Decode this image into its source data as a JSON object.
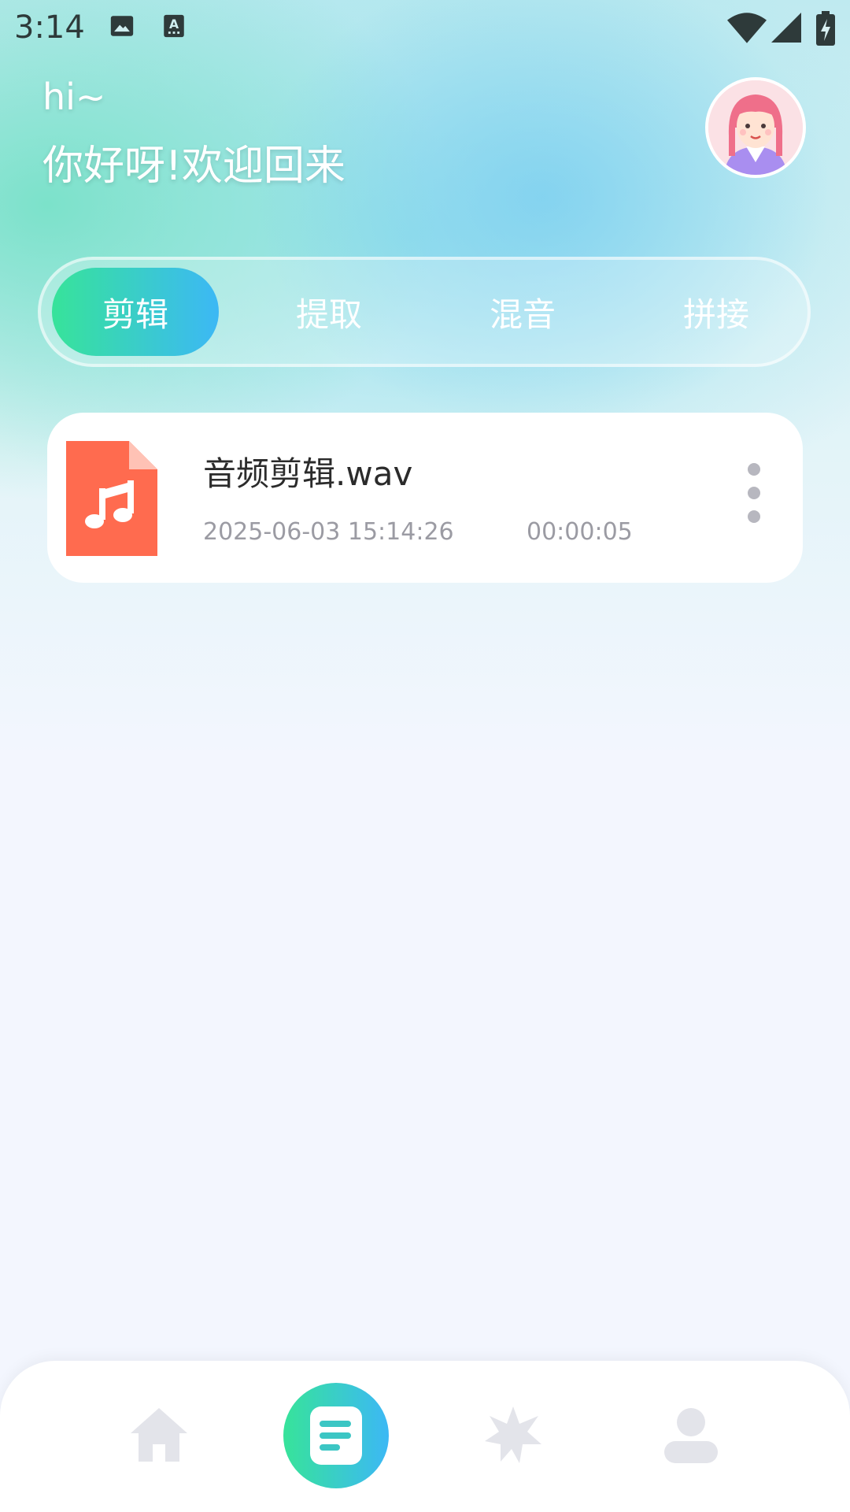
{
  "status_bar": {
    "time": "3:14",
    "left_icons": [
      "image-icon",
      "a-keyboard-icon"
    ],
    "right_icons": [
      "wifi-icon",
      "signal-icon",
      "battery-charging-icon"
    ]
  },
  "greeting": {
    "line1": "hi~",
    "line2": "你好呀!欢迎回来"
  },
  "avatar": {
    "icon": "user-avatar"
  },
  "tabs": [
    {
      "label": "剪辑",
      "active": true
    },
    {
      "label": "提取",
      "active": false
    },
    {
      "label": "混音",
      "active": false
    },
    {
      "label": "拼接",
      "active": false
    }
  ],
  "files": [
    {
      "name": "音频剪辑.wav",
      "date": "2025-06-03 15:14:26",
      "duration": "00:00:05",
      "icon": "audio-file-icon"
    }
  ],
  "bottom_nav": [
    {
      "icon": "home-icon",
      "active": false
    },
    {
      "icon": "list-icon",
      "active": true
    },
    {
      "icon": "sparkle-icon",
      "active": false
    },
    {
      "icon": "user-icon",
      "active": false
    }
  ],
  "colors": {
    "accent_start": "#37e39a",
    "accent_end": "#3cb8f5",
    "file_icon": "#ff6b4f",
    "nav_inactive": "#e3e4ea"
  }
}
